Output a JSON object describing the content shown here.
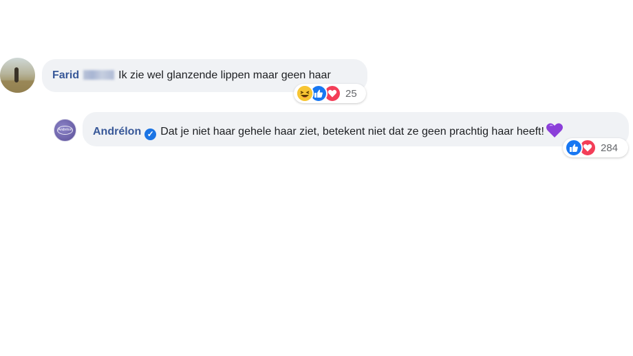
{
  "comments": [
    {
      "author": "Farid",
      "text": "Ik zie wel glanzende lippen maar geen haar",
      "reaction_count": "25",
      "reactions": [
        "haha-icon",
        "like-icon",
        "love-icon"
      ]
    },
    {
      "author": "Andrélon",
      "verified": true,
      "text": "Dat je niet haar gehele haar ziet, betekent niet dat ze geen prachtig haar heeft!",
      "emoji": "purple-heart-icon",
      "reaction_count": "284",
      "reactions": [
        "like-icon",
        "love-icon"
      ],
      "avatar_text": "Andrélon"
    }
  ],
  "colors": {
    "bubble": "#f0f2f5",
    "author": "#385898",
    "like": "#1877f2",
    "love": "#f33e58",
    "haha": "#f7c533",
    "verified": "#1b74e4",
    "purple_heart": "#8b3fd9"
  }
}
